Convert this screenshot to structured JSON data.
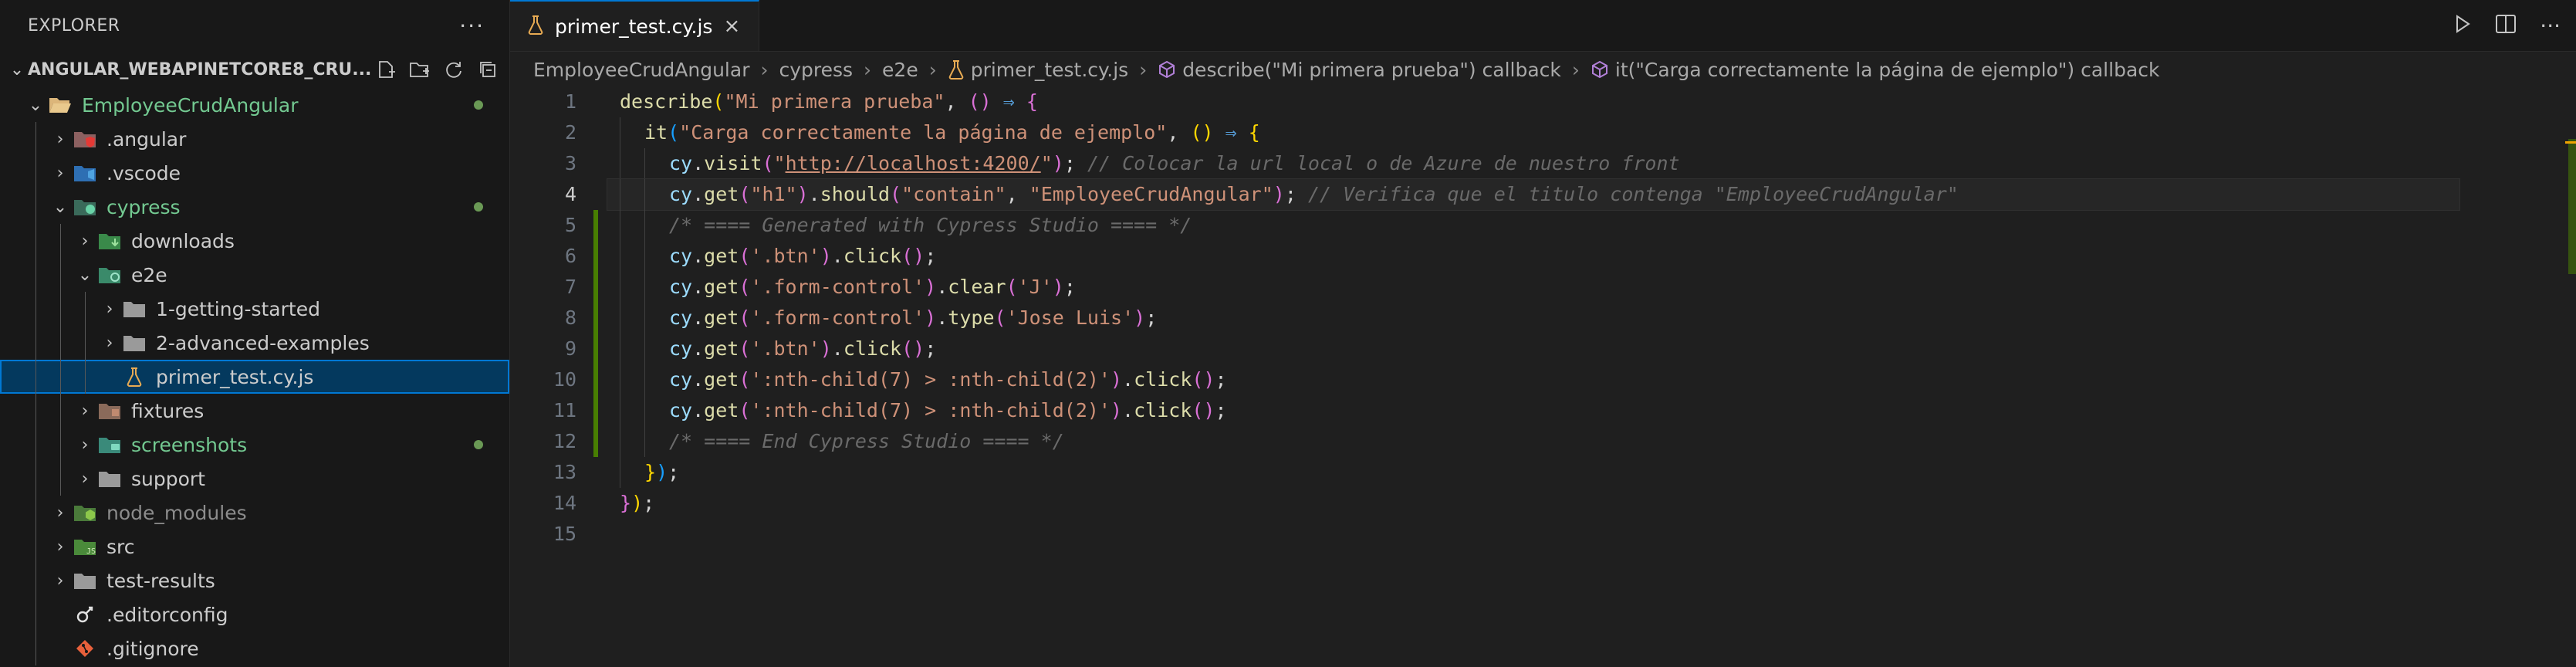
{
  "explorer": {
    "title": "EXPLORER",
    "more": "···",
    "project": "ANGULAR_WEBAPINETCORE8_CRU...",
    "tree": [
      {
        "label": "EmployeeCrudAngular",
        "depth": 0,
        "chev": "⌄",
        "icon": "folder-open-icon",
        "color": "green",
        "dot": true
      },
      {
        "label": ".angular",
        "depth": 1,
        "chev": "›",
        "icon": "angular-folder-icon",
        "color": "",
        "dot": false
      },
      {
        "label": ".vscode",
        "depth": 1,
        "chev": "›",
        "icon": "vscode-folder-icon",
        "color": "",
        "dot": false
      },
      {
        "label": "cypress",
        "depth": 1,
        "chev": "⌄",
        "icon": "cypress-folder-icon",
        "color": "green",
        "dot": true
      },
      {
        "label": "downloads",
        "depth": 2,
        "chev": "›",
        "icon": "downloads-folder-icon",
        "color": "",
        "dot": false
      },
      {
        "label": "e2e",
        "depth": 2,
        "chev": "⌄",
        "icon": "e2e-folder-icon",
        "color": "",
        "dot": false
      },
      {
        "label": "1-getting-started",
        "depth": 3,
        "chev": "›",
        "icon": "folder-icon",
        "color": "",
        "dot": false
      },
      {
        "label": "2-advanced-examples",
        "depth": 3,
        "chev": "›",
        "icon": "folder-icon",
        "color": "",
        "dot": false
      },
      {
        "label": "primer_test.cy.js",
        "depth": 3,
        "chev": "",
        "icon": "test-file-icon",
        "color": "",
        "dot": false,
        "selected": true
      },
      {
        "label": "fixtures",
        "depth": 2,
        "chev": "›",
        "icon": "fixtures-folder-icon",
        "color": "",
        "dot": false
      },
      {
        "label": "screenshots",
        "depth": 2,
        "chev": "›",
        "icon": "screenshots-folder-icon",
        "color": "green",
        "dot": true
      },
      {
        "label": "support",
        "depth": 2,
        "chev": "›",
        "icon": "folder-icon",
        "color": "",
        "dot": false
      },
      {
        "label": "node_modules",
        "depth": 1,
        "chev": "›",
        "icon": "node-folder-icon",
        "color": "gray",
        "dot": false
      },
      {
        "label": "src",
        "depth": 1,
        "chev": "›",
        "icon": "src-folder-icon",
        "color": "",
        "dot": false
      },
      {
        "label": "test-results",
        "depth": 1,
        "chev": "›",
        "icon": "folder-icon",
        "color": "",
        "dot": false
      },
      {
        "label": ".editorconfig",
        "depth": 1,
        "chev": "",
        "icon": "editorconfig-file-icon",
        "color": "",
        "dot": false
      },
      {
        "label": ".gitignore",
        "depth": 1,
        "chev": "",
        "icon": "git-file-icon",
        "color": "",
        "dot": false
      }
    ]
  },
  "tab": {
    "label": "primer_test.cy.js",
    "close": "×"
  },
  "breadcrumb": {
    "items": [
      "EmployeeCrudAngular",
      "cypress",
      "e2e",
      "primer_test.cy.js",
      "describe(\"Mi primera prueba\") callback",
      "it(\"Carga correctamente la página de ejemplo\") callback"
    ],
    "separator": "›"
  },
  "code": {
    "current_line": 4,
    "lines": [
      {
        "n": "1",
        "mod": false,
        "indent": 0,
        "tokens": [
          [
            "describe",
            "fn"
          ],
          [
            "(",
            "p1"
          ],
          [
            "\"Mi primera prueba\"",
            "str"
          ],
          [
            ", ",
            "pl"
          ],
          [
            "()",
            "p2"
          ],
          [
            " ⇒ ",
            "arr"
          ],
          [
            "{",
            "p2"
          ]
        ]
      },
      {
        "n": "2",
        "mod": false,
        "indent": 1,
        "tokens": [
          [
            "it",
            "fn"
          ],
          [
            "(",
            "p3"
          ],
          [
            "\"Carga correctamente la página de ejemplo\"",
            "str"
          ],
          [
            ", ",
            "pl"
          ],
          [
            "()",
            "p1"
          ],
          [
            " ⇒ ",
            "arr"
          ],
          [
            "{",
            "p1"
          ]
        ]
      },
      {
        "n": "3",
        "mod": false,
        "indent": 2,
        "tokens": [
          [
            "cy",
            "id"
          ],
          [
            ".",
            "pl"
          ],
          [
            "visit",
            "m"
          ],
          [
            "(",
            "p2"
          ],
          [
            "\"",
            "str"
          ],
          [
            "http://localhost:4200/",
            "url"
          ],
          [
            "\"",
            "str"
          ],
          [
            ")",
            "p2"
          ],
          [
            "; ",
            "pl"
          ],
          [
            "// Colocar la url local o de Azure de nuestro front",
            "cm2"
          ]
        ]
      },
      {
        "n": "4",
        "mod": false,
        "indent": 2,
        "tokens": [
          [
            "cy",
            "id"
          ],
          [
            ".",
            "pl"
          ],
          [
            "get",
            "m"
          ],
          [
            "(",
            "p2"
          ],
          [
            "\"h1\"",
            "str"
          ],
          [
            ")",
            "p2"
          ],
          [
            ".",
            "pl"
          ],
          [
            "should",
            "m"
          ],
          [
            "(",
            "p2"
          ],
          [
            "\"contain\"",
            "str"
          ],
          [
            ", ",
            "pl"
          ],
          [
            "\"EmployeeCrudAngular\"",
            "str"
          ],
          [
            ")",
            "p2"
          ],
          [
            "; ",
            "pl"
          ],
          [
            "// Verifica que el titulo contenga \"EmployeeCrudAngular\"",
            "cm2"
          ]
        ]
      },
      {
        "n": "5",
        "mod": true,
        "indent": 2,
        "tokens": [
          [
            "/* ==== Generated with Cypress Studio ==== */",
            "cm2"
          ]
        ]
      },
      {
        "n": "6",
        "mod": true,
        "indent": 2,
        "tokens": [
          [
            "cy",
            "id"
          ],
          [
            ".",
            "pl"
          ],
          [
            "get",
            "m"
          ],
          [
            "(",
            "p2"
          ],
          [
            "'.btn'",
            "str"
          ],
          [
            ")",
            "p2"
          ],
          [
            ".",
            "pl"
          ],
          [
            "click",
            "m"
          ],
          [
            "()",
            "p2"
          ],
          [
            ";",
            "pl"
          ]
        ]
      },
      {
        "n": "7",
        "mod": true,
        "indent": 2,
        "tokens": [
          [
            "cy",
            "id"
          ],
          [
            ".",
            "pl"
          ],
          [
            "get",
            "m"
          ],
          [
            "(",
            "p2"
          ],
          [
            "'.form-control'",
            "str"
          ],
          [
            ")",
            "p2"
          ],
          [
            ".",
            "pl"
          ],
          [
            "clear",
            "m"
          ],
          [
            "(",
            "p2"
          ],
          [
            "'J'",
            "str"
          ],
          [
            ")",
            "p2"
          ],
          [
            ";",
            "pl"
          ]
        ]
      },
      {
        "n": "8",
        "mod": true,
        "indent": 2,
        "tokens": [
          [
            "cy",
            "id"
          ],
          [
            ".",
            "pl"
          ],
          [
            "get",
            "m"
          ],
          [
            "(",
            "p2"
          ],
          [
            "'.form-control'",
            "str"
          ],
          [
            ")",
            "p2"
          ],
          [
            ".",
            "pl"
          ],
          [
            "type",
            "m"
          ],
          [
            "(",
            "p2"
          ],
          [
            "'Jose Luis'",
            "str"
          ],
          [
            ")",
            "p2"
          ],
          [
            ";",
            "pl"
          ]
        ]
      },
      {
        "n": "9",
        "mod": true,
        "indent": 2,
        "tokens": [
          [
            "cy",
            "id"
          ],
          [
            ".",
            "pl"
          ],
          [
            "get",
            "m"
          ],
          [
            "(",
            "p2"
          ],
          [
            "'.btn'",
            "str"
          ],
          [
            ")",
            "p2"
          ],
          [
            ".",
            "pl"
          ],
          [
            "click",
            "m"
          ],
          [
            "()",
            "p2"
          ],
          [
            ";",
            "pl"
          ]
        ]
      },
      {
        "n": "10",
        "mod": true,
        "indent": 2,
        "tokens": [
          [
            "cy",
            "id"
          ],
          [
            ".",
            "pl"
          ],
          [
            "get",
            "m"
          ],
          [
            "(",
            "p2"
          ],
          [
            "':nth-child(7) > :nth-child(2)'",
            "str"
          ],
          [
            ")",
            "p2"
          ],
          [
            ".",
            "pl"
          ],
          [
            "click",
            "m"
          ],
          [
            "()",
            "p2"
          ],
          [
            ";",
            "pl"
          ]
        ]
      },
      {
        "n": "11",
        "mod": true,
        "indent": 2,
        "tokens": [
          [
            "cy",
            "id"
          ],
          [
            ".",
            "pl"
          ],
          [
            "get",
            "m"
          ],
          [
            "(",
            "p2"
          ],
          [
            "':nth-child(7) > :nth-child(2)'",
            "str"
          ],
          [
            ")",
            "p2"
          ],
          [
            ".",
            "pl"
          ],
          [
            "click",
            "m"
          ],
          [
            "()",
            "p2"
          ],
          [
            ";",
            "pl"
          ]
        ]
      },
      {
        "n": "12",
        "mod": true,
        "indent": 2,
        "tokens": [
          [
            "/* ==== End Cypress Studio ==== */",
            "cm2"
          ]
        ]
      },
      {
        "n": "13",
        "mod": false,
        "indent": 1,
        "tokens": [
          [
            "}",
            "p1"
          ],
          [
            ")",
            "p3"
          ],
          [
            ";",
            "pl"
          ]
        ]
      },
      {
        "n": "14",
        "mod": false,
        "indent": 0,
        "tokens": [
          [
            "}",
            "p2"
          ],
          [
            ")",
            "p1"
          ],
          [
            ";",
            "pl"
          ]
        ]
      },
      {
        "n": "15",
        "mod": false,
        "indent": 0,
        "tokens": []
      }
    ]
  }
}
